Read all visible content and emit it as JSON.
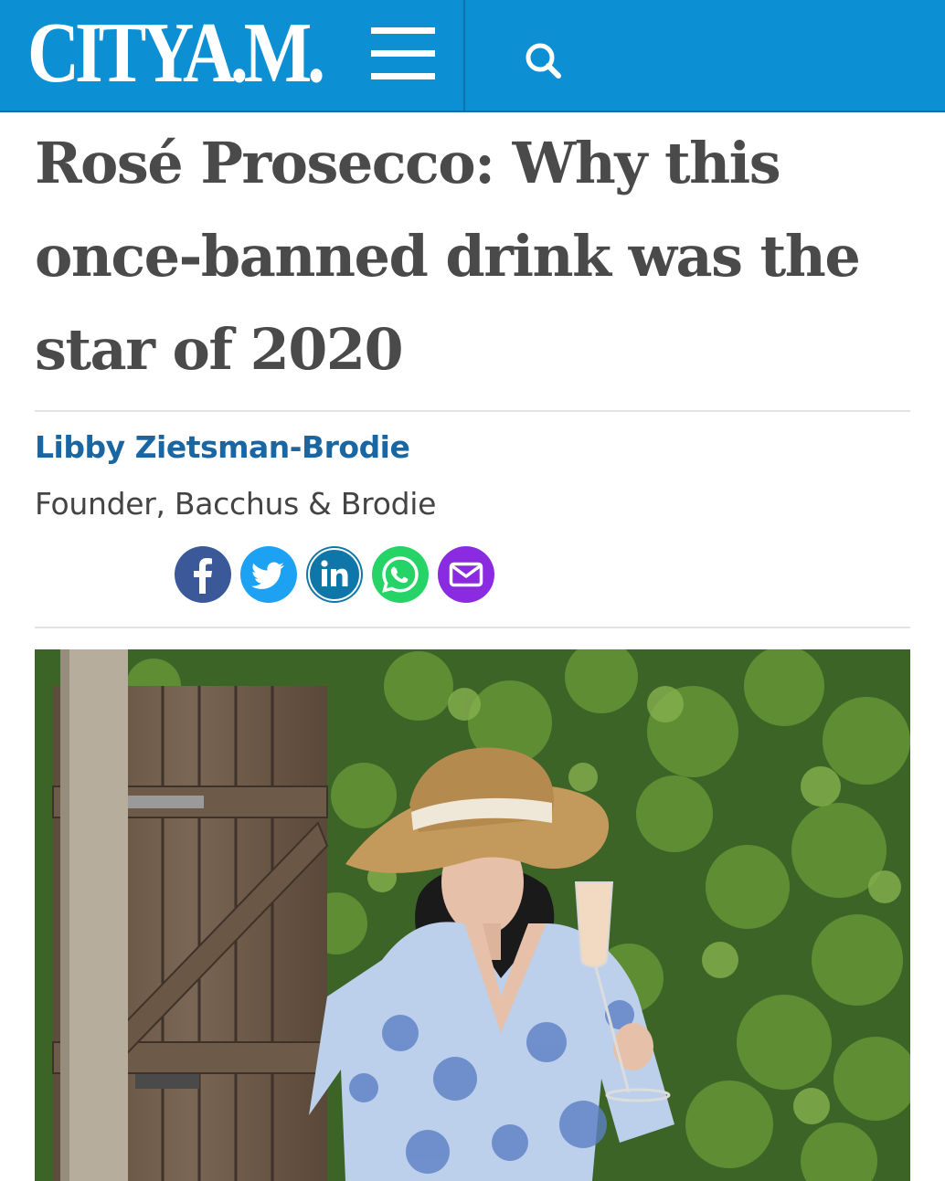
{
  "header": {
    "logo_text": "CITYA.M.",
    "menu_icon": "hamburger-menu-icon",
    "search_icon": "search-icon",
    "background_color": "#0d8fd3"
  },
  "article": {
    "headline": "Rosé Prosecco: Why this once-banned drink was the star of 2020",
    "author": "Libby Zietsman-Brodie",
    "author_role": "Founder, Bacchus & Brodie"
  },
  "share": [
    {
      "name": "facebook",
      "icon": "facebook-icon",
      "color": "#3b5998"
    },
    {
      "name": "twitter",
      "icon": "twitter-icon",
      "color": "#1da1f2"
    },
    {
      "name": "linkedin",
      "icon": "linkedin-icon",
      "color": "#0e76a8"
    },
    {
      "name": "whatsapp",
      "icon": "whatsapp-icon",
      "color": "#25d366"
    },
    {
      "name": "email",
      "icon": "email-icon",
      "color": "#8a2be2"
    }
  ]
}
